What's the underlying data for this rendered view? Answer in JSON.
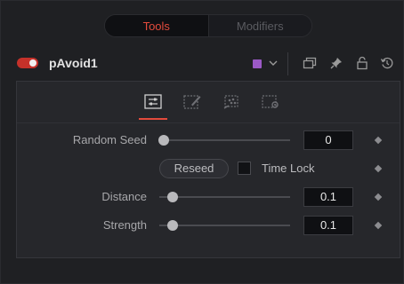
{
  "tabs": {
    "tools_label": "Tools",
    "modifiers_label": "Modifiers"
  },
  "tool": {
    "name": "pAvoid1",
    "color": "#9b59c6",
    "enabled": true
  },
  "header_icons": [
    "chevron-down-icon",
    "window-icon",
    "pin-icon",
    "lock-icon",
    "reset-icon"
  ],
  "subtabs": {
    "items": [
      "controls-icon",
      "style-icon",
      "particles-icon",
      "settings-icon"
    ],
    "active": "controls-icon"
  },
  "controls": {
    "random_seed": {
      "label": "Random Seed",
      "value": "0",
      "slider_fraction": 0.0
    },
    "reseed_label": "Reseed",
    "time_lock": {
      "label": "Time Lock",
      "checked": false
    },
    "distance": {
      "label": "Distance",
      "value": "0.1",
      "slider_fraction": 0.1
    },
    "strength": {
      "label": "Strength",
      "value": "0.1",
      "slider_fraction": 0.1
    }
  },
  "colors": {
    "accent": "#e34b3c",
    "toggle_on": "#c5312a"
  }
}
